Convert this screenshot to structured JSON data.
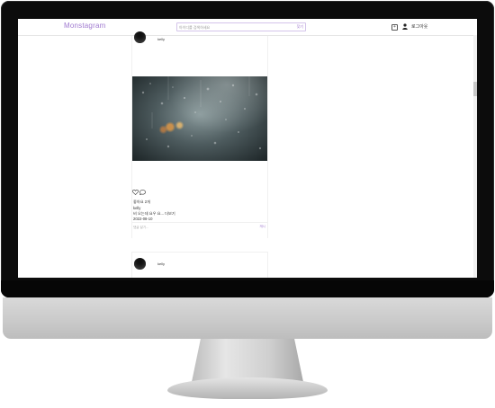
{
  "header": {
    "logo": "Monstagram",
    "search_placeholder": "아이디를 검색하세요",
    "search_button": "찾기",
    "login_label": "로그아웃"
  },
  "posts": [
    {
      "username": "kelly",
      "likes": "좋아요 2개",
      "author": "kelly",
      "caption": "비 오는데 요우 요... 더보기",
      "date": "2022-08-10",
      "comment_placeholder": "댓글 달기...",
      "post_button": "게시"
    },
    {
      "username": "kelly"
    }
  ],
  "icons": {
    "new_post": "plus-square-icon",
    "user": "user-icon",
    "like": "heart-icon",
    "comment": "comment-icon"
  },
  "colors": {
    "brand": "#a07ad0",
    "border": "#d4c4ea",
    "text": "#333333"
  }
}
